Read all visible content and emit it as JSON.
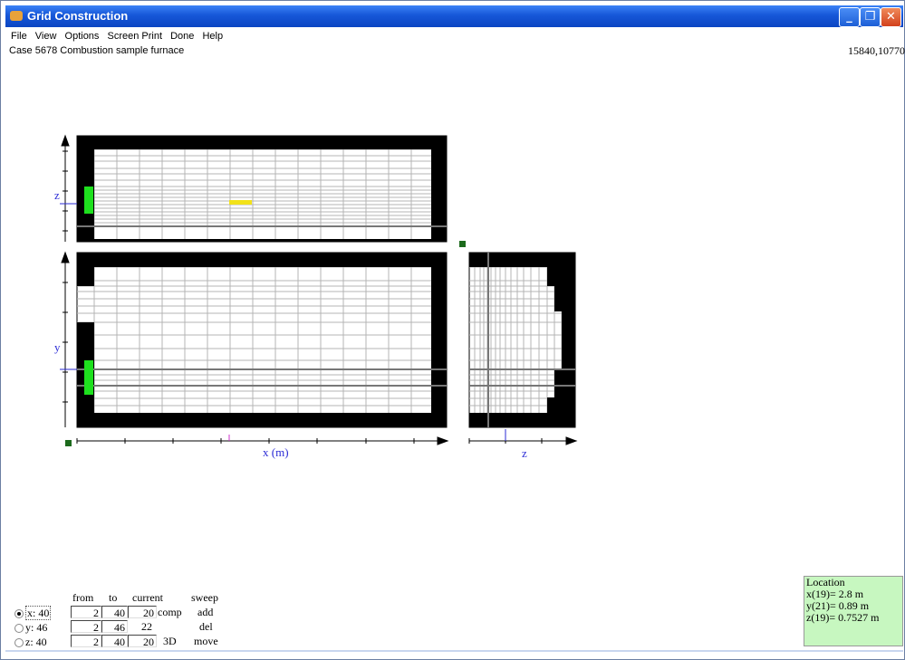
{
  "window": {
    "title": "Grid Construction",
    "minimize": "_",
    "restore": "❐",
    "close": "✕"
  },
  "menu": {
    "file": "File",
    "view": "View",
    "options": "Options",
    "screen_print": "Screen Print",
    "done": "Done",
    "help": "Help"
  },
  "case_info": "Case 5678   Combustion sample furnace",
  "coords": "15840,10770",
  "plot": {
    "z_top": "z",
    "y_mid": "y",
    "x_label": "x (m)",
    "z_right": "z"
  },
  "radios": [
    {
      "label": "x: 40",
      "checked": true
    },
    {
      "label": "y: 46",
      "checked": false
    },
    {
      "label": "z: 40",
      "checked": false
    }
  ],
  "table": {
    "headers": {
      "from": "from",
      "to": "to",
      "current": "current cell",
      "sweep": "sweep"
    },
    "rows": [
      {
        "from": "2",
        "to": "40",
        "cur": "20",
        "extra": "comp",
        "action": "add"
      },
      {
        "from": "2",
        "to": "46",
        "cur": "22",
        "extra": "",
        "action": "del"
      },
      {
        "from": "2",
        "to": "40",
        "cur": "20",
        "extra": "3D",
        "action": "move"
      }
    ]
  },
  "location": {
    "title": "Location",
    "x": "x(19)= 2.8 m",
    "y": "y(21)= 0.89 m",
    "z": "z(19)= 0.7527 m"
  },
  "colors": {
    "wall": "#000000",
    "inlet": "#1ee01e",
    "highlight": "#f2e21a",
    "axis_label": "#2b2bd6",
    "titlebar": "#1657d8",
    "location_bg": "#c7f7c0"
  }
}
